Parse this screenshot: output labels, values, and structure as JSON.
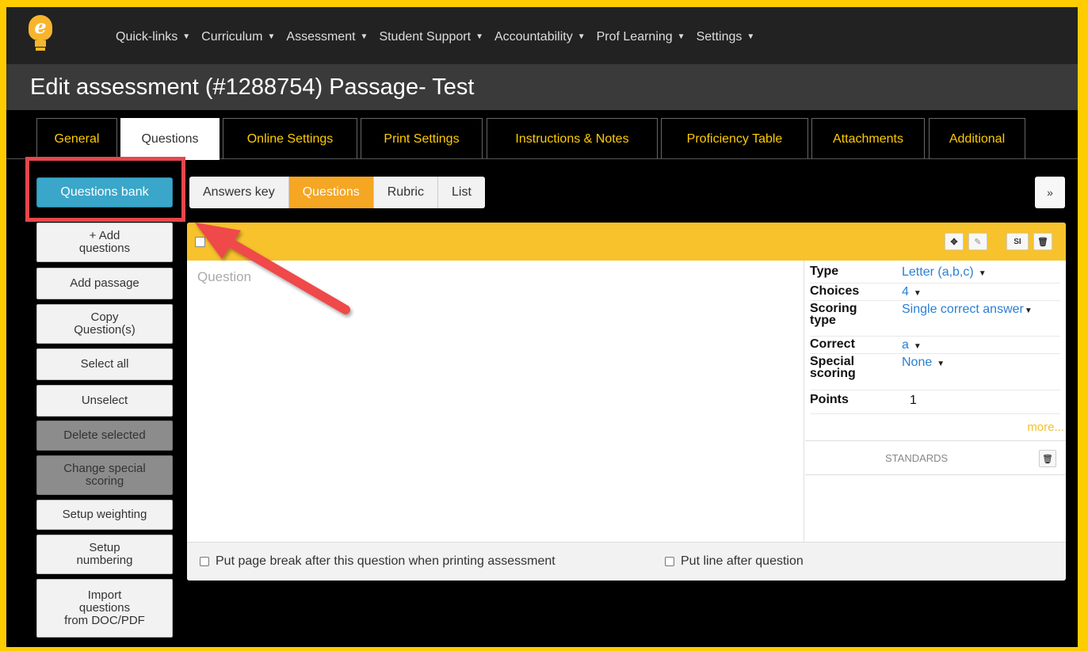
{
  "nav": {
    "items": [
      {
        "label": "Quick-links"
      },
      {
        "label": "Curriculum"
      },
      {
        "label": "Assessment"
      },
      {
        "label": "Student Support"
      },
      {
        "label": "Accountability"
      },
      {
        "label": "Prof Learning"
      },
      {
        "label": "Settings"
      }
    ],
    "logo_letter": "e"
  },
  "page": {
    "title": "Edit assessment (#1288754) Passage- Test"
  },
  "tabs": [
    {
      "label": "General"
    },
    {
      "label": "Questions"
    },
    {
      "label": "Online Settings"
    },
    {
      "label": "Print Settings"
    },
    {
      "label": "Instructions & Notes"
    },
    {
      "label": "Proficiency Table"
    },
    {
      "label": "Attachments"
    },
    {
      "label": "Additional"
    }
  ],
  "sidebar": {
    "questions_bank": "Questions bank",
    "add_questions": [
      "+ Add",
      "questions"
    ],
    "add_passage": "Add passage",
    "copy_questions": [
      "Copy",
      "Question(s)"
    ],
    "select_all": "Select all",
    "unselect": "Unselect",
    "delete_selected": "Delete selected",
    "change_special_scoring": [
      "Change special",
      "scoring"
    ],
    "setup_weighting": "Setup weighting",
    "setup_numbering": [
      "Setup",
      "numbering"
    ],
    "import_questions": [
      "Import",
      "questions",
      "from DOC/PDF"
    ]
  },
  "view_toggle": {
    "answers_key": "Answers key",
    "questions": "Questions",
    "rubric": "Rubric",
    "list": "List",
    "expand": "»"
  },
  "question_card": {
    "placeholder": "Question",
    "toolbar": {
      "move": "✥",
      "edit": "✎",
      "si": "SI",
      "delete": "🗑"
    },
    "properties": {
      "type_label": "Type",
      "type_value": "Letter (a,b,c)",
      "choices_label": "Choices",
      "choices_value": "4",
      "scoring_label": "Scoring type",
      "scoring_value": "Single correct answer",
      "correct_label": "Correct",
      "correct_value": "a",
      "special_label": "Special scoring",
      "special_value": "None",
      "points_label": "Points",
      "points_value": "1"
    },
    "more": "more...",
    "standards_label": "STANDARDS",
    "page_break_option": "Put page break after this question when printing assessment",
    "line_option": "Put line after question"
  },
  "colors": {
    "accent": "#ffcc00",
    "primary_button": "#3aa6c9",
    "annotation": "#e5474b"
  }
}
